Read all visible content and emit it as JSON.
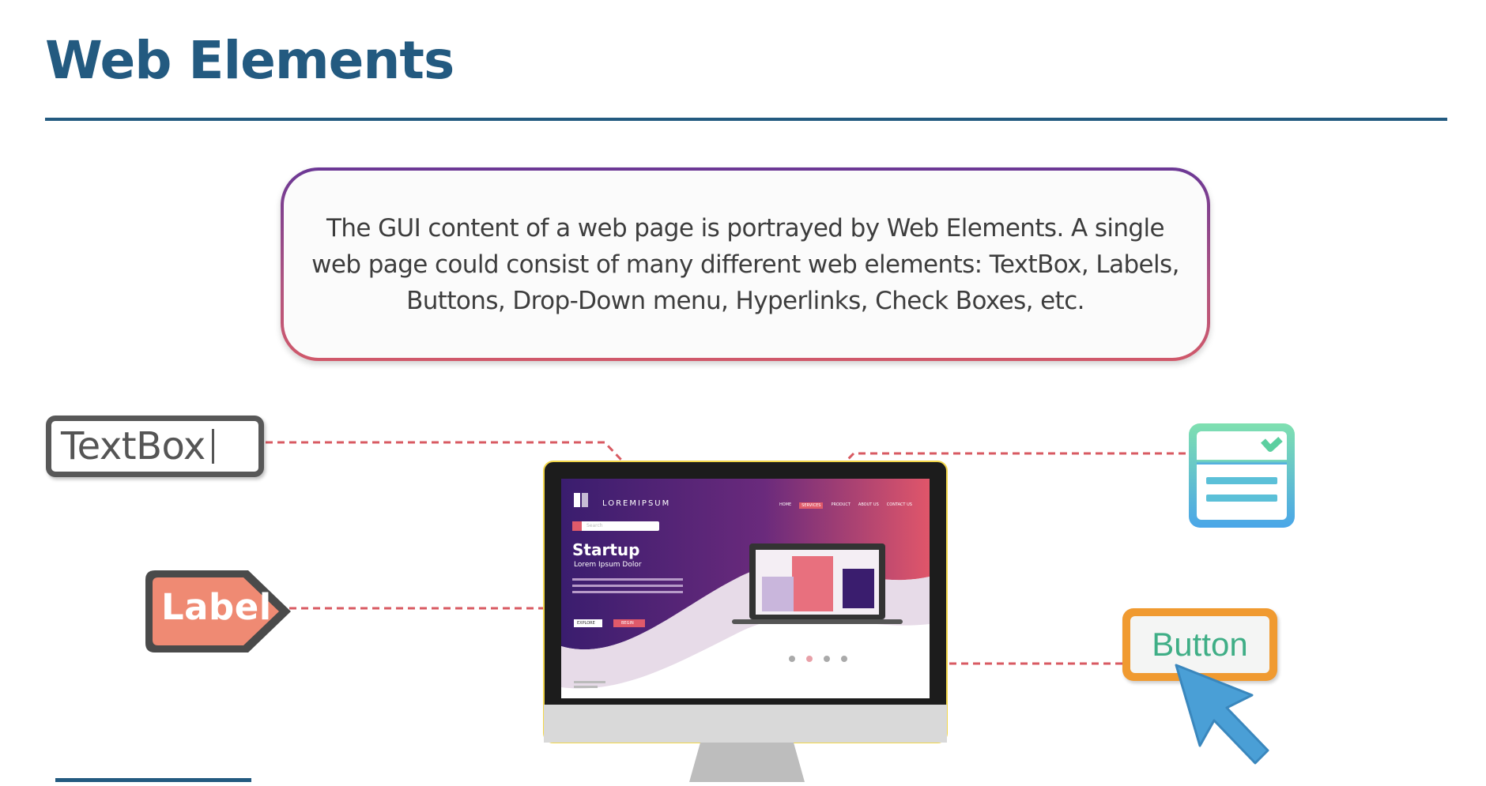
{
  "slide": {
    "title": "Web Elements",
    "description": "The GUI content of a web page is portrayed by Web Elements. A single web page could consist of many different web elements: TextBox, Labels, Buttons, Drop-Down menu, Hyperlinks, Check Boxes, etc."
  },
  "widgets": {
    "textbox_label": "TextBox",
    "label_label": "Label",
    "button_label": "Button"
  },
  "mockup_site": {
    "logo_text": "LOREMIPSUM",
    "search_placeholder": "Search",
    "hero_title": "Startup",
    "hero_subtitle": "Lorem Ipsum Dolor",
    "nav_items": [
      "HOME",
      "SERVICES",
      "PRODUCT",
      "ABOUT US",
      "CONTACT US"
    ],
    "primary_button": "EXPLORE",
    "secondary_button": "BEGIN"
  },
  "colors": {
    "title_blue": "#235a80",
    "connector_red": "#d85a62",
    "hero_purple": "#3a1d6e",
    "accent_pink": "#e05a6a",
    "button_orange": "#f09a30",
    "button_text_green": "#3fae86",
    "label_salmon": "#ef8a73",
    "cursor_blue": "#4a9fd6"
  }
}
